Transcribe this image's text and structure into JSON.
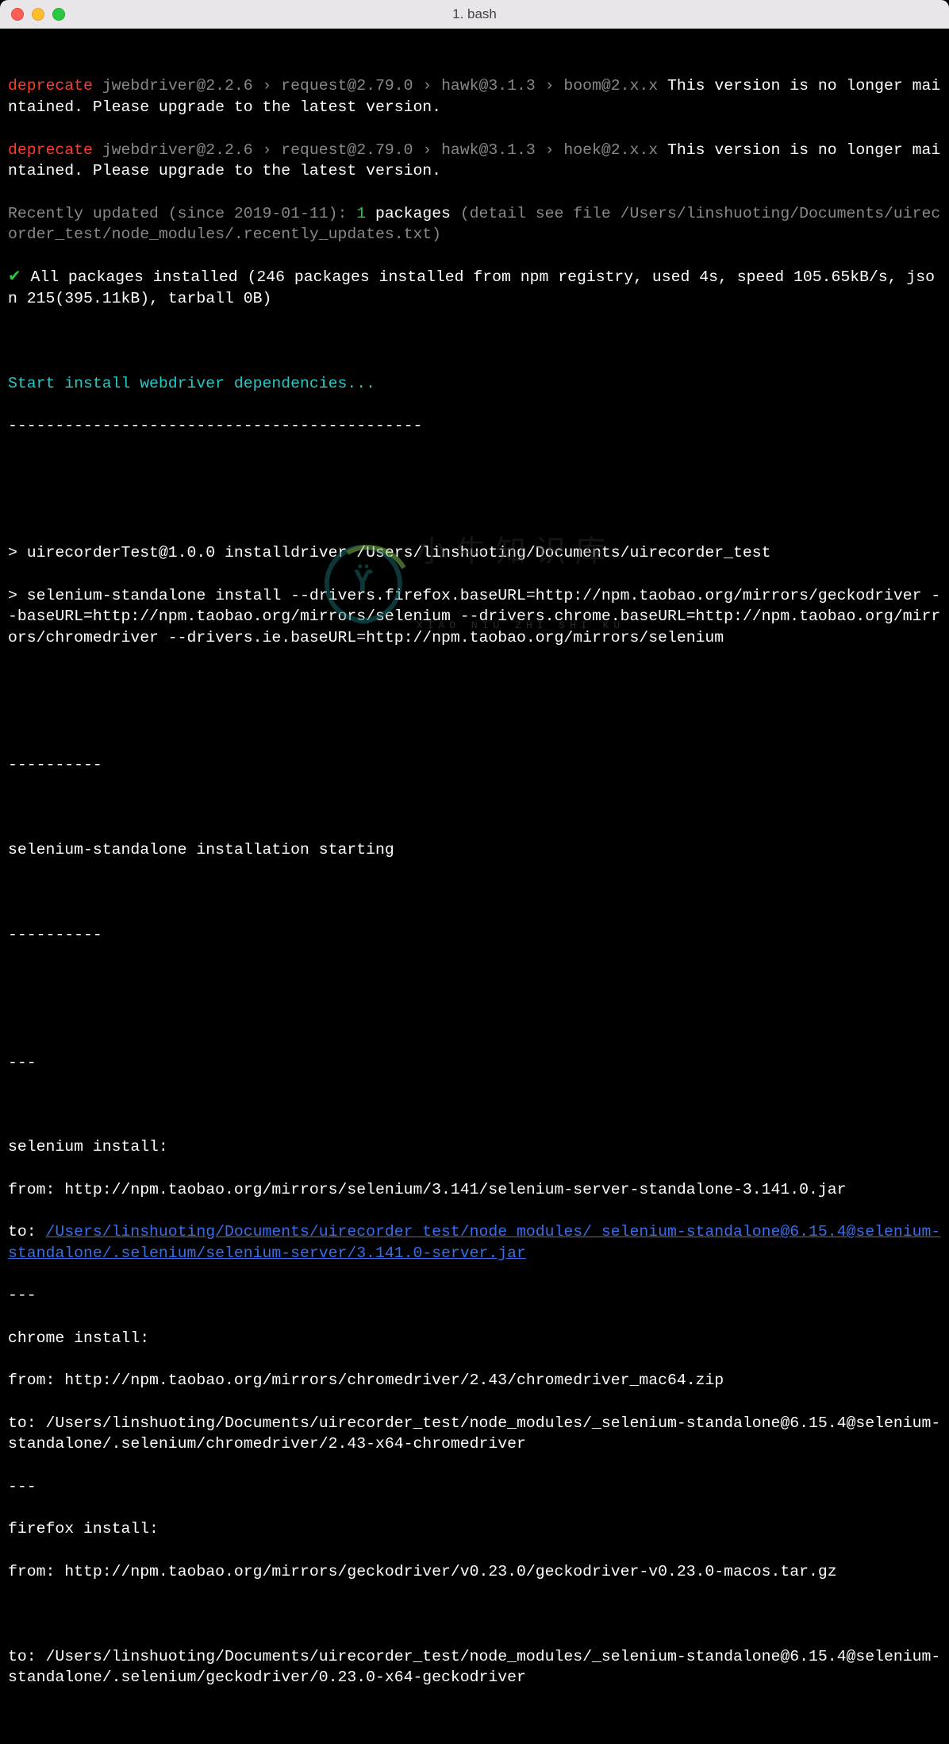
{
  "window": {
    "title": "1. bash"
  },
  "deprecate": {
    "label": "deprecate",
    "chain1": "jwebdriver@2.2.6 › request@2.79.0 › hawk@3.1.3 › boom@2.x.x ",
    "chain2": "jwebdriver@2.2.6 › request@2.79.0 › hawk@3.1.3 › hoek@2.x.x ",
    "message": "This version is no longer maintained. Please upgrade to the latest version."
  },
  "recent": {
    "prefix": "Recently updated (since 2019-01-11): ",
    "count": "1",
    "word": " packages ",
    "suffix": "(detail see file /Users/linshuoting/Documents/uirecorder_test/node_modules/.recently_updates.txt)"
  },
  "install_ok": {
    "check": "✔ ",
    "msg": "All packages installed (246 packages installed from npm registry, used 4s, speed 105.65kB/s, json 215(395.11kB), tarball 0B)"
  },
  "start_banner": "Start install webdriver dependencies...",
  "banner_dash": "--------------------------------------------",
  "script1": "> uirecorderTest@1.0.0 installdriver /Users/linshuoting/Documents/uirecorder_test",
  "script2": "> selenium-standalone install --drivers.firefox.baseURL=http://npm.taobao.org/mirrors/geckodriver --baseURL=http://npm.taobao.org/mirrors/selenium --drivers.chrome.baseURL=http://npm.taobao.org/mirrors/chromedriver --drivers.ie.baseURL=http://npm.taobao.org/mirrors/selenium",
  "dash10": "----------",
  "sel_start": "selenium-standalone installation starting",
  "dash3": "---",
  "sel": {
    "heading": "selenium install:",
    "from": "from: http://npm.taobao.org/mirrors/selenium/3.141/selenium-server-standalone-3.141.0.jar",
    "to_prefix": "to: ",
    "to_link": "/Users/linshuoting/Documents/uirecorder_test/node_modules/_selenium-standalone@6.15.4@selenium-standalone/.selenium/selenium-server/3.141.0-server.jar"
  },
  "chrome": {
    "heading": "chrome install:",
    "from": "from: http://npm.taobao.org/mirrors/chromedriver/2.43/chromedriver_mac64.zip",
    "to": "to: /Users/linshuoting/Documents/uirecorder_test/node_modules/_selenium-standalone@6.15.4@selenium-standalone/.selenium/chromedriver/2.43-x64-chromedriver"
  },
  "firefox": {
    "heading": "firefox install:",
    "from": "from: http://npm.taobao.org/mirrors/geckodriver/v0.23.0/geckodriver-v0.23.0-macos.tar.gz",
    "to": "to: /Users/linshuoting/Documents/uirecorder_test/node_modules/_selenium-standalone@6.15.4@selenium-standalone/.selenium/geckodriver/0.23.0-x64-geckodriver"
  },
  "watermark": {
    "cn": "小牛知识库",
    "en": "XIAO NIU ZHI SHI KU"
  }
}
